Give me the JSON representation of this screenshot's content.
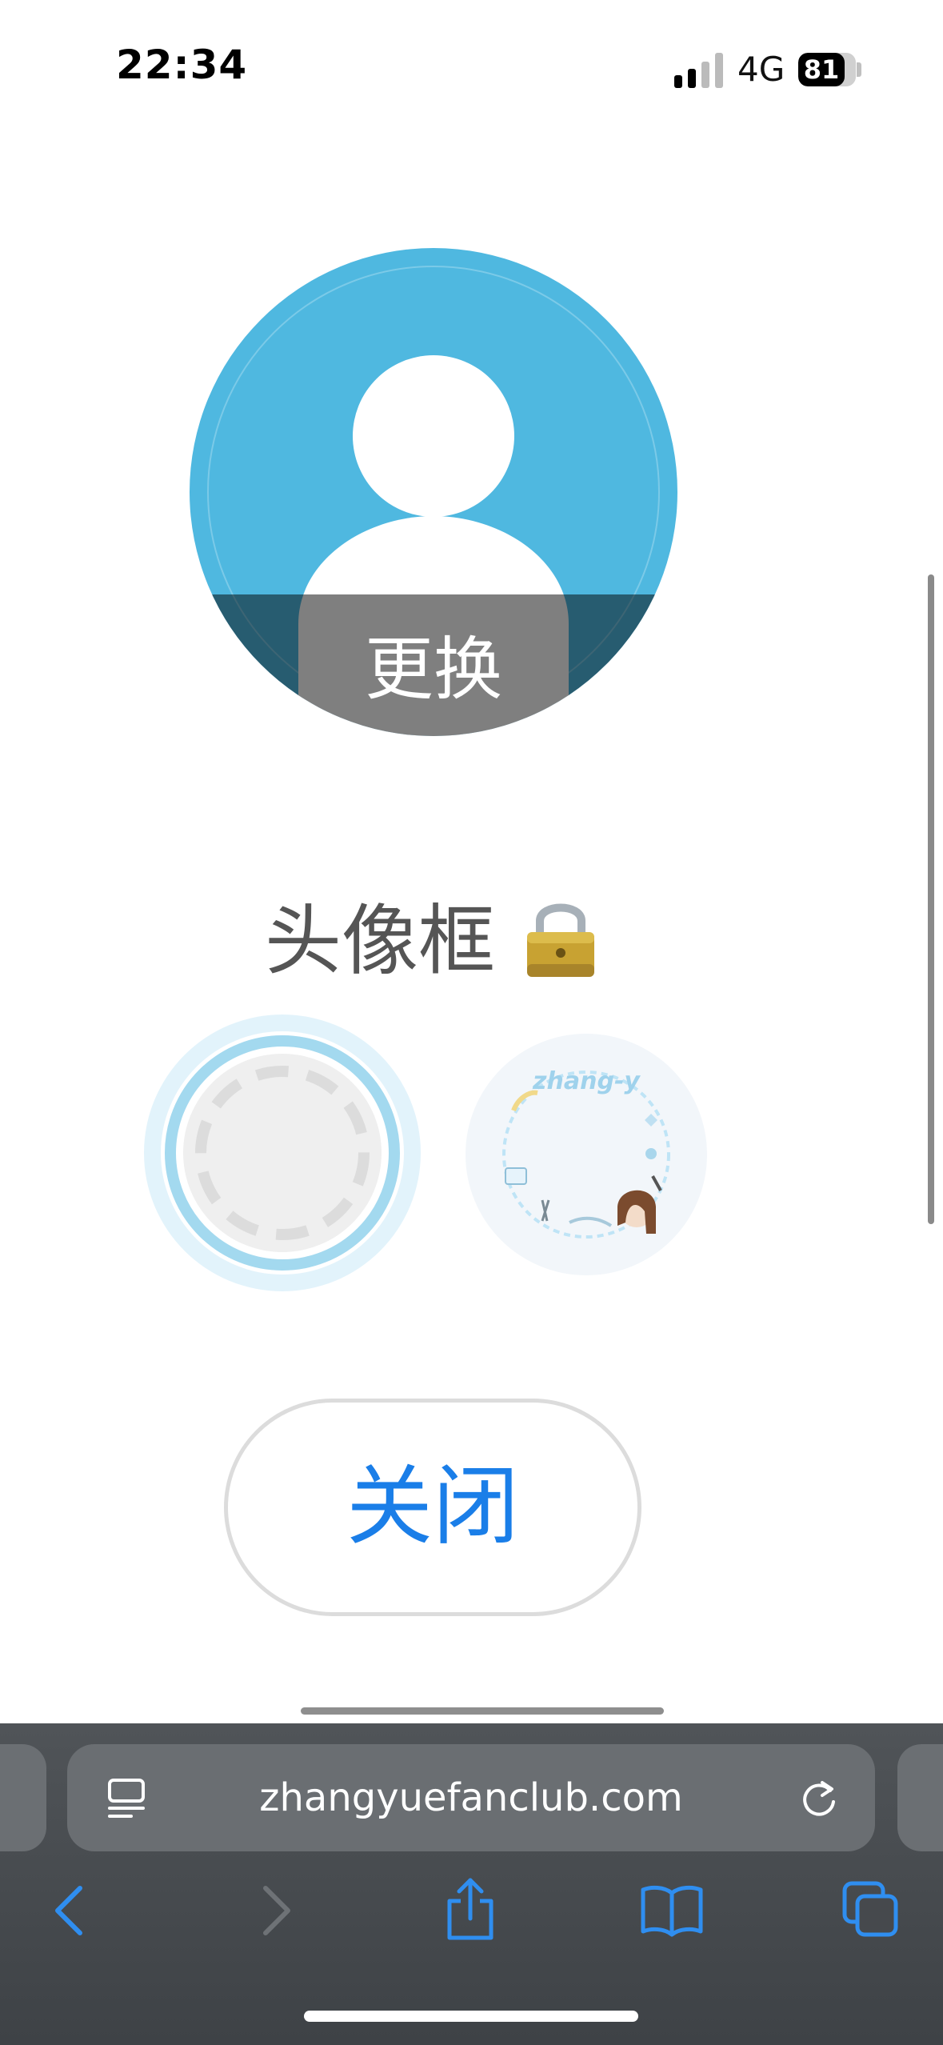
{
  "status_bar": {
    "time": "22:34",
    "network": "4G",
    "battery_level": "81",
    "battery_fraction": 0.81
  },
  "avatar": {
    "change_label": "更换",
    "icon": "person-silhouette-icon"
  },
  "avatar_frame": {
    "title": "头像框",
    "lock_icon": "lock-icon",
    "options": [
      {
        "name": "none",
        "selected": true,
        "icon": "empty-frame-icon"
      },
      {
        "name": "zhang-y",
        "selected": false,
        "text": "zhang-y",
        "icon": "fan-frame-icon"
      }
    ]
  },
  "close_button": {
    "label": "关闭"
  },
  "browser": {
    "url": "zhangyuefanclub.com",
    "toolbar": [
      "back-icon",
      "forward-icon",
      "share-icon",
      "bookmarks-icon",
      "tabs-icon"
    ]
  },
  "colors": {
    "avatar_bg": "#4fb8e0",
    "accent": "#1a7ee8",
    "toolbar_icon": "#2f8ef0",
    "browser_bar": "#46494d"
  }
}
